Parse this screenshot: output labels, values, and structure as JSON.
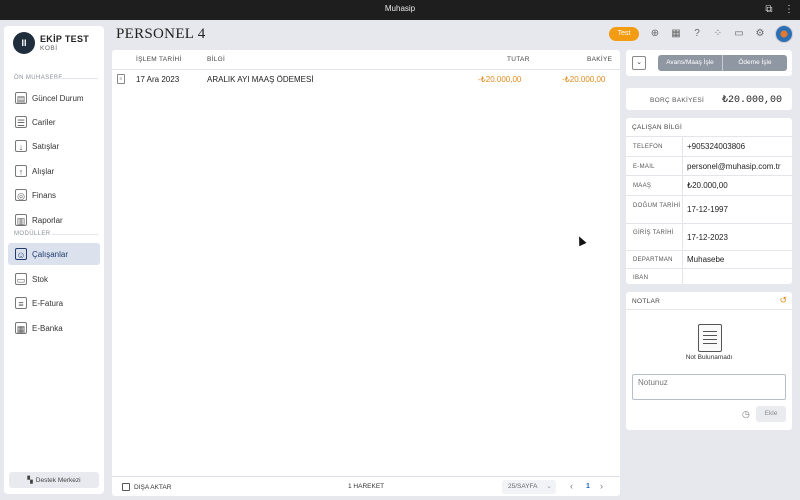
{
  "window": {
    "title": "Muhasip"
  },
  "brand": {
    "name": "EKİP TEST",
    "subtitle": "KOBİ",
    "logo_text": "II"
  },
  "sidebar": {
    "section1": "ÖN MUHASEBE",
    "items1": [
      {
        "label": "Güncel Durum",
        "icon": "dashboard-icon"
      },
      {
        "label": "Cariler",
        "icon": "accounts-icon"
      },
      {
        "label": "Satışlar",
        "icon": "sales-icon"
      },
      {
        "label": "Alışlar",
        "icon": "purchases-icon"
      },
      {
        "label": "Finans",
        "icon": "finance-icon"
      },
      {
        "label": "Raporlar",
        "icon": "reports-icon"
      }
    ],
    "section2": "MODÜLLER",
    "items2": [
      {
        "label": "Çalışanlar",
        "icon": "employees-icon",
        "active": true
      },
      {
        "label": "Stok",
        "icon": "stock-icon"
      },
      {
        "label": "E-Fatura",
        "icon": "einvoice-icon"
      },
      {
        "label": "E-Banka",
        "icon": "ebank-icon"
      }
    ],
    "support": "Destek Merkezi"
  },
  "header": {
    "title": "PERSONEL 4",
    "badge": "Test",
    "icons": [
      "add-circle-icon",
      "calendar-icon",
      "help-icon",
      "apps-icon",
      "window-icon",
      "settings-icon"
    ]
  },
  "table": {
    "columns": {
      "date": "İŞLEM TARİHİ",
      "info": "BİLGİ",
      "amount": "TUTAR",
      "balance": "BAKİYE"
    },
    "rows": [
      {
        "date": "17 Ara 2023",
        "info": "ARALIK AYI MAAŞ ÖDEMESİ",
        "amount": "-₺20.000,00",
        "balance": "-₺20.000,00"
      }
    ],
    "footer": {
      "export": "DIŞA AKTAR",
      "count": "1 HAREKET",
      "per_page": "25/SAYFA",
      "page": "1"
    }
  },
  "actions": {
    "process_salary": "Avans/Maaş İşle",
    "process_payment": "Ödeme İşle"
  },
  "balance": {
    "label": "BORÇ BAKİYESİ",
    "value": "₺20.000,00"
  },
  "employee_info": {
    "title": "ÇALIŞAN BİLGİ",
    "phone": {
      "label": "TELEFON",
      "value": "+905324003806"
    },
    "email": {
      "label": "E-MAIL",
      "value": "personel@muhasip.com.tr"
    },
    "salary": {
      "label": "MAAŞ",
      "value": "₺20.000,00"
    },
    "birth": {
      "label": "DOĞUM TARİHİ",
      "value": "17-12-1997"
    },
    "start": {
      "label": "GİRİŞ TARİHİ",
      "value": "17-12-2023"
    },
    "department": {
      "label": "DEPARTMAN",
      "value": "Muhasebe"
    },
    "iban": {
      "label": "IBAN",
      "value": ""
    }
  },
  "notes": {
    "title": "NOTLAR",
    "empty": "Not Bulunamadı",
    "placeholder": "Notunuz",
    "add": "Ekle"
  },
  "colors": {
    "accent": "#f39c12",
    "negative": "#e08a1e",
    "active_nav": "#dbe2ee",
    "button_gray": "#8f97a3"
  }
}
